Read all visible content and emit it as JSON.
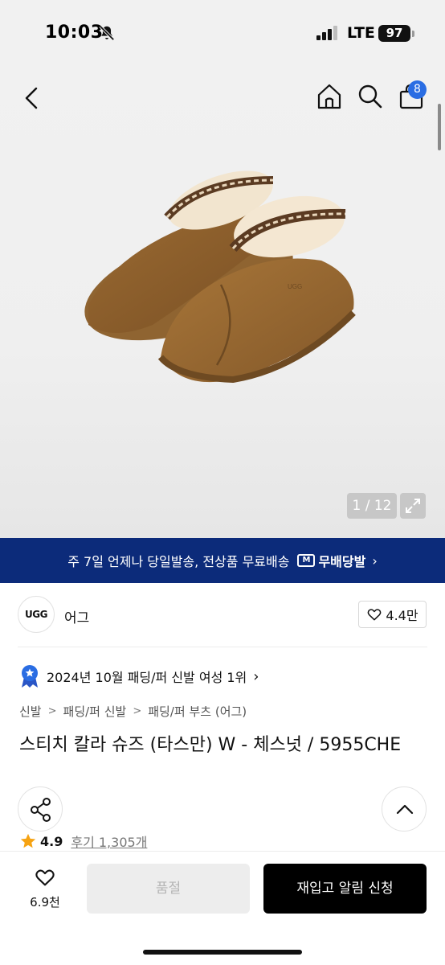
{
  "status_bar": {
    "time": "10:03",
    "network": "LTE",
    "battery": "97"
  },
  "header": {
    "cart_badge": "8"
  },
  "gallery": {
    "counter": "1 / 12"
  },
  "delivery_banner": {
    "text": "주 7일 언제나 당일발송, 전상품 무료배송",
    "badge_letter": "M",
    "logo_text": "무배당발"
  },
  "brand": {
    "logo_text": "UGG",
    "name": "어그",
    "likes": "4.4만"
  },
  "ranking": {
    "text": "2024년 10월 패딩/퍼 신발 여성 1위"
  },
  "breadcrumb": [
    "신발",
    "패딩/퍼 신발",
    "패딩/퍼 부츠 (어그)"
  ],
  "product": {
    "title": "스티치 칼라 슈즈 (타스만) W - 체스넛 / 5955CHE",
    "rating": "4.9",
    "reviews": "후기 1,305개"
  },
  "bottom_bar": {
    "wish_count": "6.9천",
    "soldout_label": "품절",
    "restock_label": "재입고 알림 신청"
  },
  "colors": {
    "banner_bg": "#0c2b7a",
    "cart_badge": "#2a6de3",
    "star": "#f6a313"
  }
}
